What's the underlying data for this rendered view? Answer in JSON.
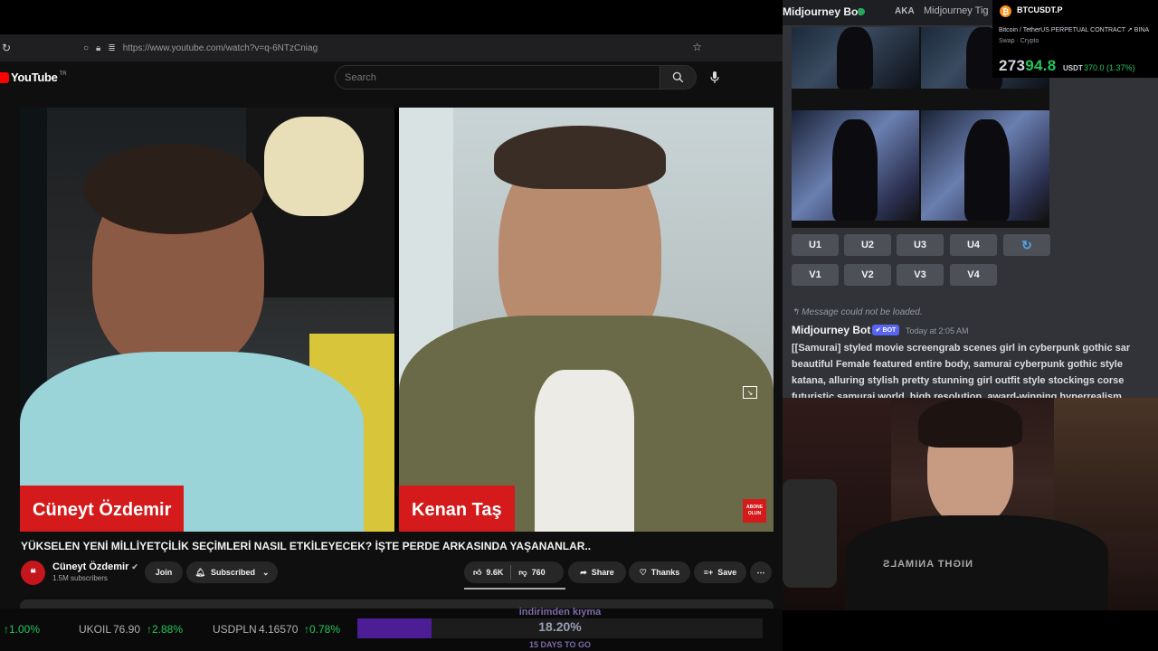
{
  "browser": {
    "url": "https://www.youtube.com/watch?v=q-6NTzCniag"
  },
  "youtube": {
    "logo_text": "YouTube",
    "region": "TR",
    "search_placeholder": "Search",
    "video": {
      "left_name_tag": "Cüneyt Özdemir",
      "right_name_tag": "Kenan Taş",
      "subscribe_badge_line1": "ABONE",
      "subscribe_badge_line2": "OLUN",
      "title": "YÜKSELEN YENİ MİLLİYETÇİLİK SEÇİMLERİ NASIL ETKİLEYECEK? İŞTE PERDE ARKASINDA YAŞANANLAR.."
    },
    "channel": {
      "name": "Cüneyt Özdemir",
      "subscribers": "1.5M subscribers",
      "join_label": "Join",
      "subscribed_label": "Subscribed"
    },
    "actions": {
      "likes": "9.6K",
      "dislikes": "760",
      "share_label": "Share",
      "thanks_label": "Thanks",
      "save_label": "Save"
    }
  },
  "ticker": {
    "items": [
      {
        "symbol": "",
        "value": "",
        "change": "1.00%"
      },
      {
        "symbol": "UKOIL",
        "value": "76.90",
        "change": "2.88%"
      },
      {
        "symbol": "USDPLN",
        "value": "4.16570",
        "change": "0.78%"
      }
    ]
  },
  "promo": {
    "title": "indirimden kıyma",
    "percent": "18.20%",
    "progress": 0.182,
    "subtitle": "15 DAYS TO GO"
  },
  "discord": {
    "channel_title": "Midjourney Bot",
    "aka_label": "AKA",
    "aka_name": "Midjourney Tig",
    "upscale_buttons": [
      "U1",
      "U2",
      "U3",
      "U4"
    ],
    "variation_buttons": [
      "V1",
      "V2",
      "V3",
      "V4"
    ],
    "failed_message": "Message could not be loaded.",
    "bot_name": "Midjourney Bot",
    "bot_badge": "BOT",
    "timestamp": "Today at 2:05 AM",
    "prompt_lines": [
      "[[Samurai] styled movie screengrab scenes girl in cyberpunk gothic sar",
      "beautiful Female featured entire body, samurai cyberpunk gothic style",
      "katana, alluring stylish pretty stunning girl outfit style stockings corse",
      "futuristic samurai world, high resolution, award-winning hyperrealism"
    ]
  },
  "crypto": {
    "pair": "BTCUSDT.P",
    "description": "Bitcoin / TetherUS PERPETUAL CONTRACT",
    "exchange": "BINA",
    "category": "Swap · Crypto",
    "price_main": "273",
    "price_tail": "94.8",
    "unit": "USDT",
    "change": "370.0 (1.37%)"
  },
  "webcam": {
    "shirt_text": "NIGHT ANIMALS"
  },
  "colors": {
    "youtube_red": "#ff0000",
    "name_tag_red": "#d41a1a",
    "positive_green": "#22c55e",
    "discord_bg": "#313338",
    "discord_blurple": "#5865f2",
    "promo_purple": "#4c1d95"
  }
}
